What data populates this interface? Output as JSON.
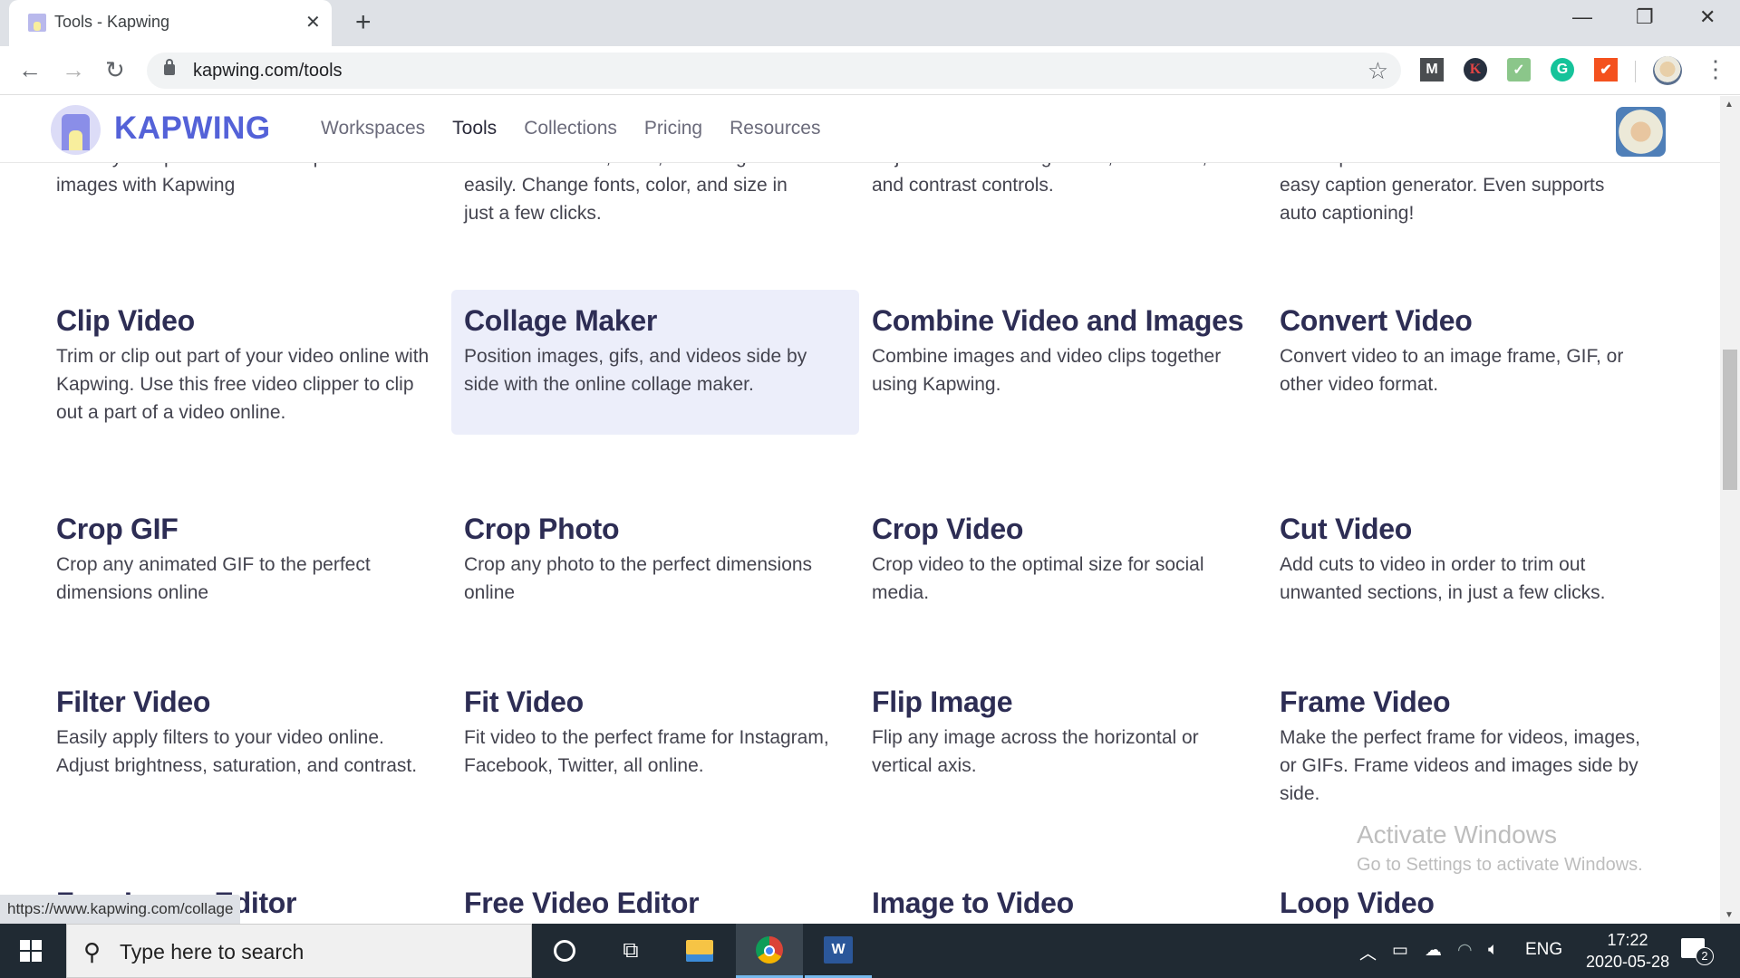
{
  "browser": {
    "tab_title": "Tools - Kapwing",
    "url": "kapwing.com/tools",
    "status_url": "https://www.kapwing.com/collage",
    "window_controls": {
      "minimize": "—",
      "restore": "❐",
      "close": "✕"
    }
  },
  "extensions": [
    "M",
    "K",
    "✓",
    "G",
    "✔"
  ],
  "site": {
    "logo_text": "KAPWING",
    "nav": [
      {
        "label": "Workspaces",
        "active": false
      },
      {
        "label": "Tools",
        "active": true
      },
      {
        "label": "Collections",
        "active": false
      },
      {
        "label": "Pricing",
        "active": false
      },
      {
        "label": "Resources",
        "active": false
      }
    ],
    "brand_color": "#5462d8",
    "title_color": "#2d2d54"
  },
  "partial_row": [
    {
      "line1": "Overlay and position text on top of",
      "line2": "images with Kapwing"
    },
    {
      "line1": "Add text to video, GIFs, and images",
      "line2": "easily. Change fonts, color, and size in",
      "line3": "just a few clicks."
    },
    {
      "line1": "Adjust video with brightness, saturation,",
      "line2": "and contrast controls."
    },
    {
      "line1": "Add captions to video online with this",
      "line2": "easy caption generator. Even supports",
      "line3": "auto captioning!"
    }
  ],
  "tools": [
    {
      "title": "Clip Video",
      "desc": "Trim or clip out part of your video online with Kapwing. Use this free video clipper to clip out a part of a video online."
    },
    {
      "title": "Collage Maker",
      "desc": "Position images, gifs, and videos side by side with the online collage maker.",
      "hovered": true
    },
    {
      "title": "Combine Video and Images",
      "desc": "Combine images and video clips together using Kapwing."
    },
    {
      "title": "Convert Video",
      "desc": "Convert video to an image frame, GIF, or other video format."
    },
    {
      "title": "Crop GIF",
      "desc": "Crop any animated GIF to the perfect dimensions online"
    },
    {
      "title": "Crop Photo",
      "desc": "Crop any photo to the perfect dimensions online"
    },
    {
      "title": "Crop Video",
      "desc": "Crop video to the optimal size for social media."
    },
    {
      "title": "Cut Video",
      "desc": "Add cuts to video in order to trim out unwanted sections, in just a few clicks."
    },
    {
      "title": "Filter Video",
      "desc": "Easily apply filters to your video online. Adjust brightness, saturation, and contrast."
    },
    {
      "title": "Fit Video",
      "desc": "Fit video to the perfect frame for Instagram, Facebook, Twitter, all online."
    },
    {
      "title": "Flip Image",
      "desc": "Flip any image across the horizontal or vertical axis."
    },
    {
      "title": "Frame Video",
      "desc": "Make the perfect frame for videos, images, or GIFs. Frame videos and images side by side."
    },
    {
      "title": "Free Image Editor",
      "desc": ""
    },
    {
      "title": "Free Video Editor",
      "desc": ""
    },
    {
      "title": "Image to Video",
      "desc": ""
    },
    {
      "title": "Loop Video",
      "desc": ""
    }
  ],
  "watermark": {
    "line1": "Activate Windows",
    "line2": "Go to Settings to activate Windows."
  },
  "taskbar": {
    "search_placeholder": "Type here to search",
    "language": "ENG",
    "time": "17:22",
    "date": "2020-05-28",
    "notification_count": "2"
  }
}
